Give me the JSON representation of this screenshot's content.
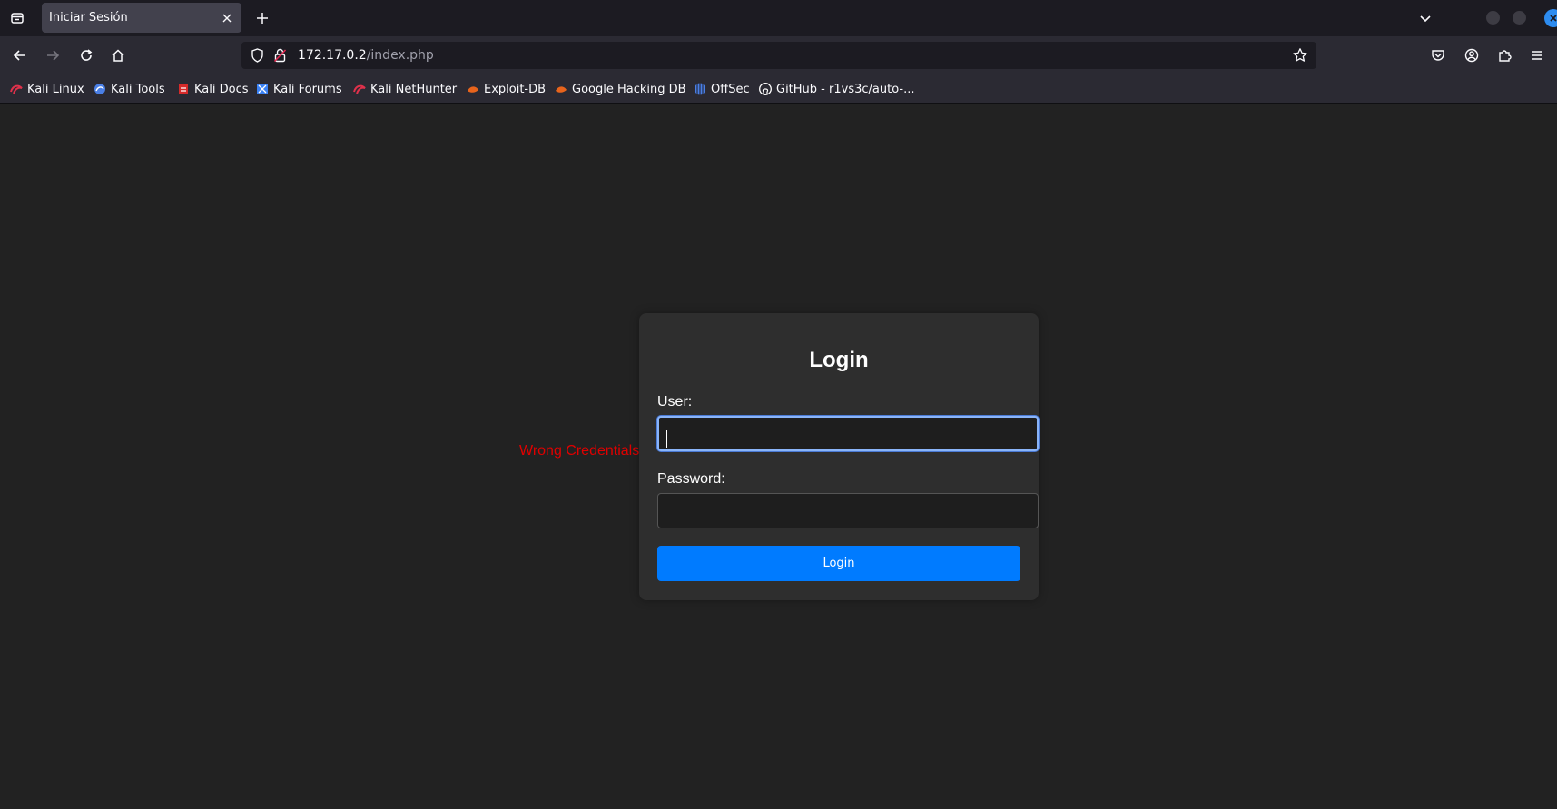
{
  "browser": {
    "tab": {
      "title": "Iniciar Sesión"
    },
    "url": {
      "host": "172.17.0.2",
      "path": "/index.php"
    },
    "bookmarks": [
      {
        "label": "Kali Linux",
        "icon": "kali-icon",
        "color": "#e0314b"
      },
      {
        "label": "Kali Tools",
        "icon": "kali-tools-icon",
        "color": "#4a7fe6"
      },
      {
        "label": "Kali Docs",
        "icon": "kali-docs-icon",
        "color": "#d62a2a"
      },
      {
        "label": "Kali Forums",
        "icon": "kali-forums-icon",
        "color": "#3b82f6"
      },
      {
        "label": "Kali NetHunter",
        "icon": "nethunter-icon",
        "color": "#e0314b"
      },
      {
        "label": "Exploit-DB",
        "icon": "exploit-db-icon",
        "color": "#e8641c"
      },
      {
        "label": "Google Hacking DB",
        "icon": "ghdb-icon",
        "color": "#e8641c"
      },
      {
        "label": "OffSec",
        "icon": "offsec-icon",
        "color": "#4a7fe6"
      },
      {
        "label": "GitHub - r1vs3c/auto-...",
        "icon": "github-icon",
        "color": "#ffffff"
      }
    ]
  },
  "page": {
    "error": "Wrong Credentials",
    "form": {
      "title": "Login",
      "user_label": "User:",
      "user_value": "",
      "password_label": "Password:",
      "password_value": "",
      "submit_label": "Login"
    }
  },
  "colors": {
    "accent": "#007bff",
    "error": "#e00000",
    "page_bg": "#222222",
    "card_bg": "#2e2e2e"
  }
}
